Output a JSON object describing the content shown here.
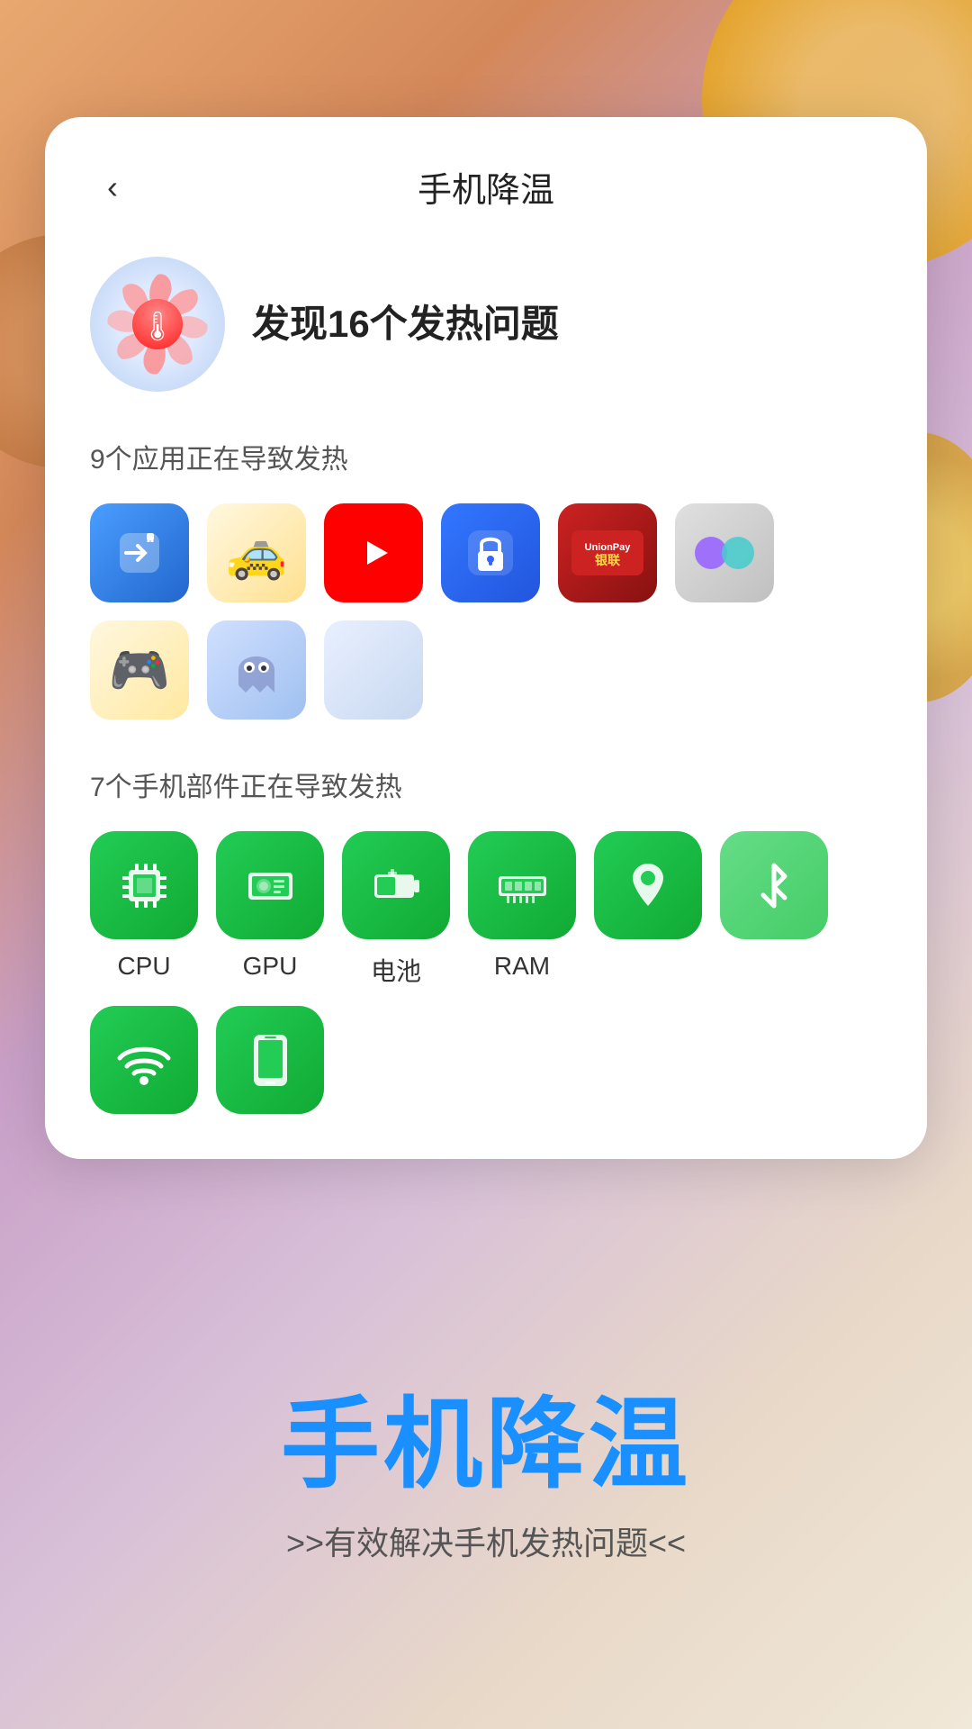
{
  "background": {
    "gradient_start": "#e8a870",
    "gradient_end": "#f0e8d8"
  },
  "card": {
    "back_button": "‹",
    "title": "手机降温",
    "heat_count_text": "发现16个发热问题",
    "apps_section_label": "9个应用正在导致发热",
    "components_section_label": "7个手机部件正在导致发热"
  },
  "apps": [
    {
      "name": "migrate-app",
      "type": "migrate"
    },
    {
      "name": "taxi-app",
      "type": "taxi"
    },
    {
      "name": "youtube-app",
      "type": "youtube"
    },
    {
      "name": "lock-app",
      "type": "lock"
    },
    {
      "name": "unionpay-app",
      "type": "unionpay"
    },
    {
      "name": "circles-app",
      "type": "circles"
    },
    {
      "name": "gamepad-app",
      "type": "gamepad"
    },
    {
      "name": "ghost-app",
      "type": "ghost"
    },
    {
      "name": "placeholder-app",
      "type": "placeholder"
    }
  ],
  "components": [
    {
      "id": "cpu",
      "label": "CPU",
      "icon": "cpu",
      "color": "green"
    },
    {
      "id": "gpu",
      "label": "GPU",
      "icon": "gpu",
      "color": "green"
    },
    {
      "id": "battery",
      "label": "电池",
      "icon": "battery",
      "color": "green"
    },
    {
      "id": "ram",
      "label": "RAM",
      "icon": "ram",
      "color": "green"
    },
    {
      "id": "location",
      "label": "",
      "icon": "location",
      "color": "green"
    },
    {
      "id": "bluetooth",
      "label": "",
      "icon": "bluetooth",
      "color": "light-green"
    },
    {
      "id": "wifi",
      "label": "",
      "icon": "wifi",
      "color": "green"
    },
    {
      "id": "screen",
      "label": "",
      "icon": "screen",
      "color": "green"
    }
  ],
  "bottom": {
    "big_title": "手机降温",
    "subtitle": ">>有效解决手机发热问题<<"
  }
}
